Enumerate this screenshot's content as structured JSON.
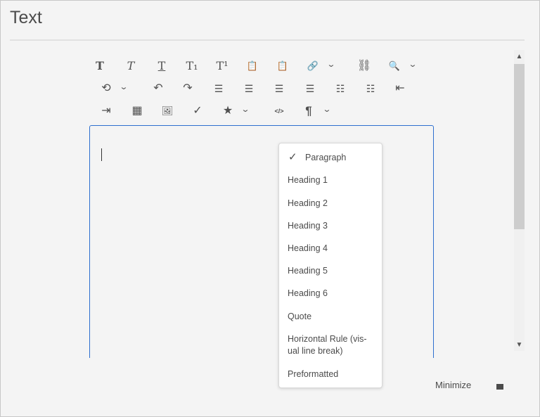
{
  "title": "Text",
  "toolbar": {
    "bold": "T",
    "italic": "T",
    "underline": "T",
    "subscript": "T₁",
    "superscript": "T¹",
    "paste_text": "📋",
    "paste_html": "📋",
    "link": "🔗",
    "unlink": "⛓",
    "find": "🔍",
    "find_replace": "⟲",
    "undo": "↶",
    "redo": "↷",
    "align_left": "☰",
    "align_center": "☰",
    "align_right": "☰",
    "justify": "☰",
    "bullet_list": "☷",
    "numbered_list": "☷",
    "outdent": "⇤",
    "indent": "⇥",
    "table": "▦",
    "image": "🖼",
    "spellcheck": "✓",
    "special_chars": "★",
    "source_edit": "</>",
    "paragraph_format": "¶",
    "chevron": "⌄"
  },
  "dropdown": {
    "selected": "Paragraph",
    "items": [
      "Paragraph",
      "Heading 1",
      "Heading 2",
      "Heading 3",
      "Heading 4",
      "Heading 5",
      "Heading 6",
      "Quote",
      "Horizontal Rule (vis-ual line break)",
      "Preformatted"
    ]
  },
  "footer": {
    "minimize_label": "Minimize"
  }
}
